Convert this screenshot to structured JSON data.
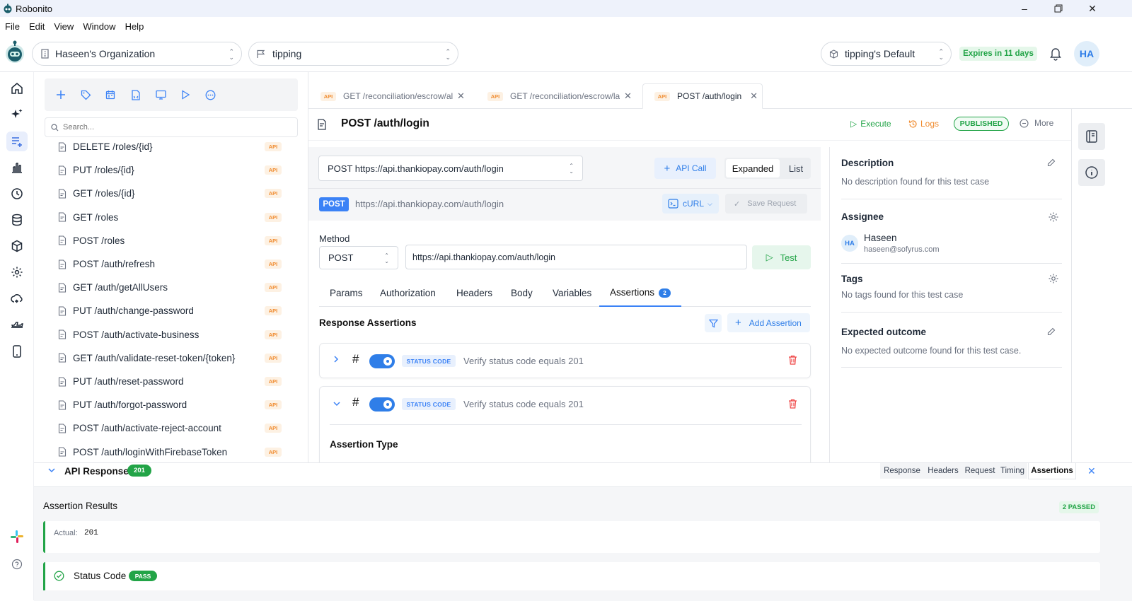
{
  "app": {
    "title": "Robonito"
  },
  "menu": [
    "File",
    "Edit",
    "View",
    "Window",
    "Help"
  ],
  "header": {
    "org": "Haseen's Organization",
    "project": "tipping",
    "environment": "tipping's Default",
    "expires": "Expires in 11 days",
    "avatar": "HA"
  },
  "list": {
    "search_placeholder": "Search...",
    "badge": "API",
    "items": [
      "DELETE /roles/{id}",
      "PUT /roles/{id}",
      "GET /roles/{id}",
      "GET /roles",
      "POST /roles",
      "POST /auth/refresh",
      "GET /auth/getAllUsers",
      "PUT /auth/change-password",
      "POST /auth/activate-business",
      "GET /auth/validate-reset-token/{token}",
      "PUT /auth/reset-password",
      "PUT /auth/forgot-password",
      "POST /auth/activate-reject-account",
      "POST /auth/loginWithFirebaseToken"
    ]
  },
  "tabs": [
    {
      "badge": "API",
      "label": "GET /reconciliation/escrow/all..."
    },
    {
      "badge": "API",
      "label": "GET /reconciliation/escrow/lat..."
    },
    {
      "badge": "API",
      "label": "POST /auth/login"
    }
  ],
  "request": {
    "title": "POST /auth/login",
    "execute": "Execute",
    "logs": "Logs",
    "status": "PUBLISHED",
    "more": "More",
    "selector": "POST https://api.thankiopay.com/auth/login",
    "api_call": "API Call",
    "view_expanded": "Expanded",
    "view_list": "List",
    "method_badge": "POST",
    "url_display": "https://api.thankiopay.com/auth/login",
    "curl": "cURL",
    "save": "Save Request",
    "method_label": "Method",
    "method_value": "POST",
    "url_value": "https://api.thankiopay.com/auth/login",
    "test": "Test",
    "subtabs": [
      "Params",
      "Authorization",
      "Headers",
      "Body",
      "Variables",
      "Assertions"
    ],
    "assertions_count": "2",
    "response_assertions": "Response Assertions",
    "add_assertion": "Add Assertion",
    "assertions": [
      {
        "hash": "#",
        "chip": "STATUS CODE",
        "text": "Verify status code equals 201"
      },
      {
        "hash": "#",
        "chip": "STATUS CODE",
        "text": "Verify status code equals 201"
      }
    ],
    "assertion_type": "Assertion Type"
  },
  "details": {
    "description_title": "Description",
    "description_text": "No description found for this test case",
    "assignee_title": "Assignee",
    "assignee_initials": "HA",
    "assignee_name": "Haseen",
    "assignee_email": "haseen@sofyrus.com",
    "tags_title": "Tags",
    "tags_text": "No tags found for this test case",
    "outcome_title": "Expected outcome",
    "outcome_text": "No expected outcome found for this test case."
  },
  "response": {
    "title": "API Response",
    "code": "201",
    "tabs": [
      "Response",
      "Headers",
      "Request",
      "Timing",
      "Assertions"
    ],
    "results_title": "Assertion Results",
    "passed": "2 PASSED",
    "actual_label": "Actual:",
    "actual_value": "201",
    "status_code": "Status Code",
    "pass": "PASS"
  },
  "colors": {
    "accent": "#3b82f6",
    "success": "#22a447",
    "api_badge": "#f08c30"
  }
}
